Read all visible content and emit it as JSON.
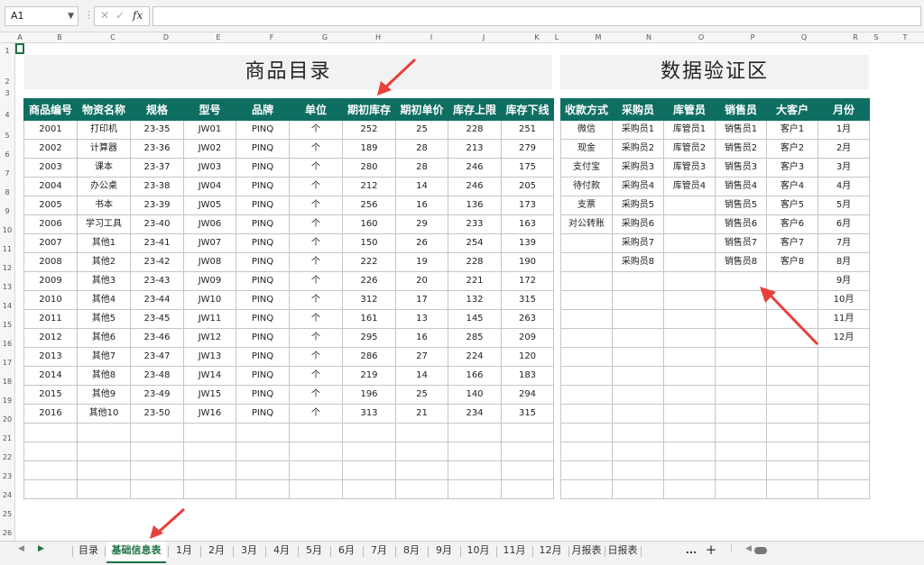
{
  "formula_bar": {
    "cell_ref": "A1",
    "fx_label": "fx",
    "value": ""
  },
  "columns": [
    "A",
    "B",
    "C",
    "D",
    "E",
    "F",
    "G",
    "H",
    "I",
    "J",
    "K",
    "L",
    "M",
    "N",
    "O",
    "P",
    "Q",
    "R",
    "S",
    "T"
  ],
  "rows": [
    "1",
    "2",
    "3",
    "4",
    "5",
    "6",
    "7",
    "8",
    "9",
    "10",
    "11",
    "12",
    "13",
    "14",
    "15",
    "16",
    "17",
    "18",
    "19",
    "20",
    "21",
    "22",
    "23",
    "24",
    "25",
    "26"
  ],
  "left_title": "商品目录",
  "right_title": "数据验证区",
  "left_headers": [
    "商品编号",
    "物资名称",
    "规格",
    "型号",
    "品牌",
    "单位",
    "期初库存",
    "期初单价",
    "库存上限",
    "库存下线"
  ],
  "left_rows": [
    [
      "2001",
      "打印机",
      "23-35",
      "JW01",
      "PINQ",
      "个",
      "252",
      "25",
      "228",
      "251"
    ],
    [
      "2002",
      "计算器",
      "23-36",
      "JW02",
      "PINQ",
      "个",
      "189",
      "28",
      "213",
      "279"
    ],
    [
      "2003",
      "课本",
      "23-37",
      "JW03",
      "PINQ",
      "个",
      "280",
      "28",
      "246",
      "175"
    ],
    [
      "2004",
      "办公桌",
      "23-38",
      "JW04",
      "PINQ",
      "个",
      "212",
      "14",
      "246",
      "205"
    ],
    [
      "2005",
      "书本",
      "23-39",
      "JW05",
      "PINQ",
      "个",
      "256",
      "16",
      "136",
      "173"
    ],
    [
      "2006",
      "学习工具",
      "23-40",
      "JW06",
      "PINQ",
      "个",
      "160",
      "29",
      "233",
      "163"
    ],
    [
      "2007",
      "其他1",
      "23-41",
      "JW07",
      "PINQ",
      "个",
      "150",
      "26",
      "254",
      "139"
    ],
    [
      "2008",
      "其他2",
      "23-42",
      "JW08",
      "PINQ",
      "个",
      "222",
      "19",
      "228",
      "190"
    ],
    [
      "2009",
      "其他3",
      "23-43",
      "JW09",
      "PINQ",
      "个",
      "226",
      "20",
      "221",
      "172"
    ],
    [
      "2010",
      "其他4",
      "23-44",
      "JW10",
      "PINQ",
      "个",
      "312",
      "17",
      "132",
      "315"
    ],
    [
      "2011",
      "其他5",
      "23-45",
      "JW11",
      "PINQ",
      "个",
      "161",
      "13",
      "145",
      "263"
    ],
    [
      "2012",
      "其他6",
      "23-46",
      "JW12",
      "PINQ",
      "个",
      "295",
      "16",
      "285",
      "209"
    ],
    [
      "2013",
      "其他7",
      "23-47",
      "JW13",
      "PINQ",
      "个",
      "286",
      "27",
      "224",
      "120"
    ],
    [
      "2014",
      "其他8",
      "23-48",
      "JW14",
      "PINQ",
      "个",
      "219",
      "14",
      "166",
      "183"
    ],
    [
      "2015",
      "其他9",
      "23-49",
      "JW15",
      "PINQ",
      "个",
      "196",
      "25",
      "140",
      "294"
    ],
    [
      "2016",
      "其他10",
      "23-50",
      "JW16",
      "PINQ",
      "个",
      "313",
      "21",
      "234",
      "315"
    ],
    [
      "",
      "",
      "",
      "",
      "",
      "",
      "",
      "",
      "",
      ""
    ],
    [
      "",
      "",
      "",
      "",
      "",
      "",
      "",
      "",
      "",
      ""
    ],
    [
      "",
      "",
      "",
      "",
      "",
      "",
      "",
      "",
      "",
      ""
    ],
    [
      "",
      "",
      "",
      "",
      "",
      "",
      "",
      "",
      "",
      ""
    ]
  ],
  "right_headers": [
    "收款方式",
    "采购员",
    "库管员",
    "销售员",
    "大客户",
    "月份"
  ],
  "right_rows": [
    [
      "微信",
      "采购员1",
      "库管员1",
      "销售员1",
      "客户1",
      "1月"
    ],
    [
      "现金",
      "采购员2",
      "库管员2",
      "销售员2",
      "客户2",
      "2月"
    ],
    [
      "支付宝",
      "采购员3",
      "库管员3",
      "销售员3",
      "客户3",
      "3月"
    ],
    [
      "待付款",
      "采购员4",
      "库管员4",
      "销售员4",
      "客户4",
      "4月"
    ],
    [
      "支票",
      "采购员5",
      "",
      "销售员5",
      "客户5",
      "5月"
    ],
    [
      "对公转账",
      "采购员6",
      "",
      "销售员6",
      "客户6",
      "6月"
    ],
    [
      "",
      "采购员7",
      "",
      "销售员7",
      "客户7",
      "7月"
    ],
    [
      "",
      "采购员8",
      "",
      "销售员8",
      "客户8",
      "8月"
    ],
    [
      "",
      "",
      "",
      "",
      "",
      "9月"
    ],
    [
      "",
      "",
      "",
      "",
      "",
      "10月"
    ],
    [
      "",
      "",
      "",
      "",
      "",
      "11月"
    ],
    [
      "",
      "",
      "",
      "",
      "",
      "12月"
    ],
    [
      "",
      "",
      "",
      "",
      "",
      ""
    ],
    [
      "",
      "",
      "",
      "",
      "",
      ""
    ],
    [
      "",
      "",
      "",
      "",
      "",
      ""
    ],
    [
      "",
      "",
      "",
      "",
      "",
      ""
    ],
    [
      "",
      "",
      "",
      "",
      "",
      ""
    ],
    [
      "",
      "",
      "",
      "",
      "",
      ""
    ],
    [
      "",
      "",
      "",
      "",
      "",
      ""
    ],
    [
      "",
      "",
      "",
      "",
      "",
      ""
    ]
  ],
  "tabs": [
    "目录",
    "基础信息表",
    "1月",
    "2月",
    "3月",
    "4月",
    "5月",
    "6月",
    "7月",
    "8月",
    "9月",
    "10月",
    "11月",
    "12月",
    "月报表",
    "日报表"
  ],
  "active_tab": "基础信息表",
  "more_tabs": "...",
  "add_sheet": "+",
  "accent_color": "#0f6e62",
  "arrow_color": "#e8403a"
}
